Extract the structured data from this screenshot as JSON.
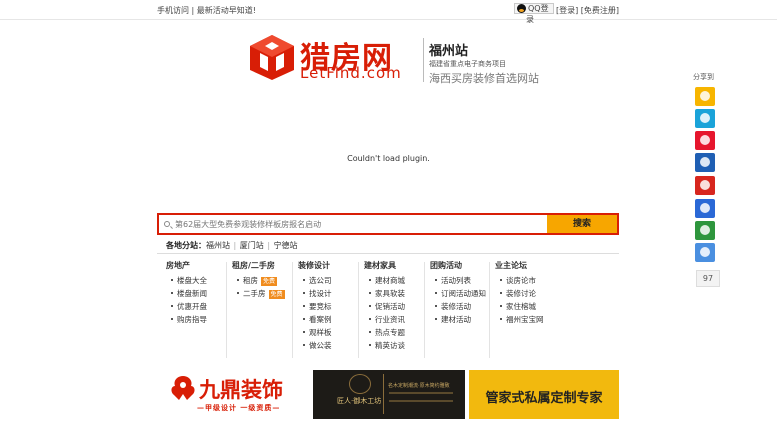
{
  "topbar": {
    "left_text": "手机访问 | 最新活动早知道!",
    "qq_label": "QQ登",
    "qq_label_2": "录",
    "login_link": "[登录]",
    "register_link": "[免费注册]"
  },
  "logo": {
    "cn_name": "猎房网",
    "en_name": "LetFind.com"
  },
  "station": {
    "city": "福州站",
    "sub": "福建省重点电子商务项目",
    "slogan": "海西买房装修首选网站"
  },
  "plugin_message": "Couldn't load plugin.",
  "share": {
    "title": "分享到",
    "count": "97",
    "icons": [
      {
        "name": "qzone-icon",
        "color": "#f7b500"
      },
      {
        "name": "tencent-weibo-icon",
        "color": "#1aa3d9"
      },
      {
        "name": "sina-weibo-icon",
        "color": "#e6162d"
      },
      {
        "name": "renren-icon",
        "color": "#1f5fb4"
      },
      {
        "name": "kaixin-icon",
        "color": "#d7261e"
      },
      {
        "name": "baidu-icon",
        "color": "#2a68d6"
      },
      {
        "name": "douban-icon",
        "color": "#2e963d"
      },
      {
        "name": "more-share-icon",
        "color": "#4a8fe0"
      }
    ]
  },
  "search": {
    "placeholder": "第62届大型免费参观装修样板房报名启动",
    "button_label": "搜索"
  },
  "substations": {
    "label": "各地分站：",
    "items": [
      "福州站",
      "厦门站",
      "宁德站"
    ]
  },
  "categories": [
    {
      "title": "房地产",
      "items": [
        "楼盘大全",
        "楼盘新闻",
        "优惠开盘",
        "购房指导"
      ]
    },
    {
      "title": "租房/二手房",
      "items": [
        "租房",
        "二手房"
      ],
      "tags": [
        "免费",
        "免费"
      ]
    },
    {
      "title": "装修设计",
      "items": [
        "选公司",
        "找设计",
        "要竞标",
        "看案例",
        "观样板",
        "做公装"
      ]
    },
    {
      "title": "建材家具",
      "items": [
        "建材商城",
        "家具软装",
        "促销活动",
        "行业资讯",
        "热点专题",
        "精英访谈"
      ]
    },
    {
      "title": "团购活动",
      "items": [
        "活动列表",
        "订阅活动通知",
        "装修活动",
        "建材活动"
      ]
    },
    {
      "title": "业主论坛",
      "items": [
        "谈房论市",
        "装修讨论",
        "家住榕城",
        "福州宝宝网"
      ]
    }
  ],
  "ads": {
    "ad1_name": "九鼎装饰",
    "ad1_sub": "—甲级设计 一级资质—",
    "ad2_left": "匠人·御木工坊",
    "ad2_right": "名木定制潮流·原木简约雅致",
    "ad3_text": "管家式私属定制专家"
  },
  "colors": {
    "brand_red": "#d81e06",
    "search_button": "#f7a600",
    "tag_orange": "#f08c1e"
  }
}
